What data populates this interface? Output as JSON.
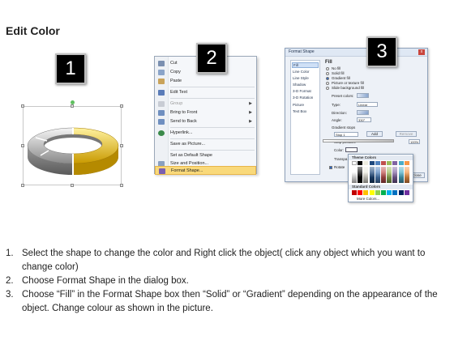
{
  "title": "Edit Color",
  "badges": [
    "1",
    "2",
    "3"
  ],
  "context_menu": {
    "items": [
      {
        "label": "Cut",
        "arrow": ""
      },
      {
        "label": "Copy",
        "arrow": ""
      },
      {
        "label": "Paste",
        "arrow": ""
      },
      {
        "label": "Edit Text",
        "arrow": ""
      },
      {
        "label": "Group",
        "arrow": "▶"
      },
      {
        "label": "Bring to Front",
        "arrow": "▶"
      },
      {
        "label": "Send to Back",
        "arrow": "▶"
      },
      {
        "label": "Hyperlink...",
        "arrow": ""
      },
      {
        "label": "Save as Picture...",
        "arrow": ""
      },
      {
        "label": "Set as Default Shape",
        "arrow": ""
      },
      {
        "label": "Size and Position...",
        "arrow": ""
      },
      {
        "label": "Format Shape...",
        "arrow": ""
      }
    ]
  },
  "format_dialog": {
    "title": "Format Shape",
    "close": "x",
    "categories": [
      "Fill",
      "Line Color",
      "Line Style",
      "Shadow",
      "3-D Format",
      "3-D Rotation",
      "Picture",
      "Text Box"
    ],
    "section": "Fill",
    "fill_options": [
      "No fill",
      "Solid fill",
      "Gradient fill",
      "Picture or texture fill",
      "Slide background fill"
    ],
    "preset_colors": "Preset colors:",
    "type_label": "Type:",
    "type_value": "Linear",
    "direction_label": "Direction:",
    "angle_label": "Angle:",
    "angle_value": "330°",
    "gradient_stops": "Gradient stops",
    "stop_value": "Stop 1",
    "add_btn": "Add",
    "remove_btn": "Remove",
    "stop_position": "Stop position:",
    "stop_pct": "100%",
    "color_label": "Color:",
    "transparency": "Transpa",
    "rotate": "Rotate",
    "close_btn": "Close"
  },
  "palette": {
    "theme_header": "Theme Colors",
    "standard_header": "Standard Colors",
    "more": "More Colors...",
    "theme_top": [
      "#ffffff",
      "#000000",
      "#eeece1",
      "#1f497d",
      "#4f81bd",
      "#c0504d",
      "#9bbb59",
      "#8064a2",
      "#4bacc6",
      "#f79646"
    ],
    "standard": [
      "#c00000",
      "#ff0000",
      "#ffc000",
      "#ffff00",
      "#92d050",
      "#00b050",
      "#00b0f0",
      "#0070c0",
      "#002060",
      "#7030a0"
    ]
  },
  "steps": [
    {
      "num": "1.",
      "text": "Select the shape to change the color and Right click the object( click any object which you want to change color)"
    },
    {
      "num": "2.",
      "text": "Choose Format Shape in the dialog box."
    },
    {
      "num": "3.",
      "text": "Choose “Fill” in the Format Shape box then “Solid” or “Gradient” depending on the appearance of the object. Change colour as shown in the picture."
    }
  ]
}
